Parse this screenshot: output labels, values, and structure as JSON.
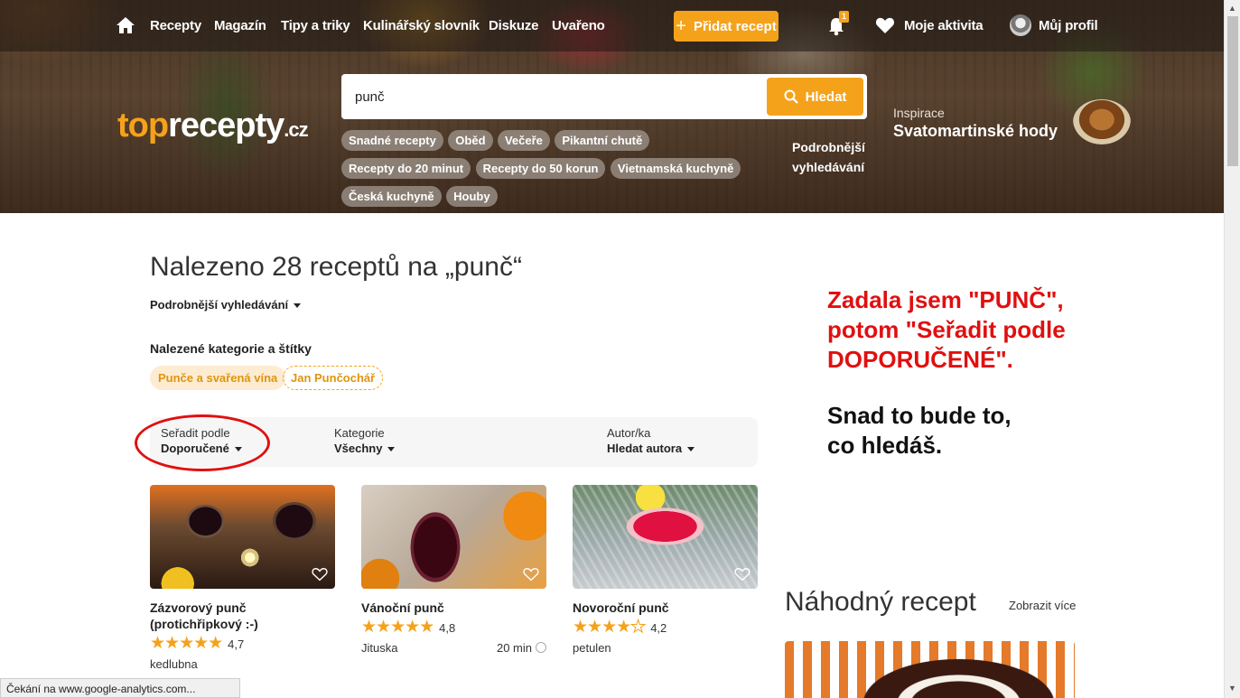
{
  "nav": {
    "home_icon": "home-icon",
    "links": [
      "Recepty",
      "Magazín",
      "Tipy a triky",
      "Kulinářský slovník",
      "Diskuze",
      "Uvařeno"
    ],
    "add_recipe": "Přidat recept",
    "notification_count": "1",
    "activity": "Moje aktivita",
    "profile": "Můj profil"
  },
  "logo": {
    "part1": "top",
    "part2": "recepty",
    "part3": ".cz"
  },
  "search": {
    "value": "punč",
    "button": "Hledat"
  },
  "quick_tags": [
    "Snadné recepty",
    "Oběd",
    "Večeře",
    "Pikantní chutě",
    "Recepty do 20 minut",
    "Recepty do 50 korun",
    "Vietnamská kuchyně",
    "Česká kuchyně",
    "Houby"
  ],
  "advanced_search_hero": "Podrobnější vyhledávání",
  "inspiration": {
    "label": "Inspirace",
    "title": "Svatomartinské hody"
  },
  "results": {
    "title": "Nalezeno 28 receptů na „punč“",
    "advanced_toggle": "Podrobnější vyhledávání",
    "categories_heading": "Nalezené kategorie a štítky",
    "category_tags": [
      "Punče a svařená vína",
      "Jan Punčochář"
    ]
  },
  "filters": [
    {
      "label": "Seřadit podle",
      "value": "Doporučené"
    },
    {
      "label": "Kategorie",
      "value": "Všechny"
    },
    {
      "label": "Autor/ka",
      "value": "Hledat autora"
    }
  ],
  "annotation": {
    "red_lines": [
      "Zadala jsem \"PUNČ\",",
      "potom \"Seřadit podle",
      "DOPORUČENÉ\"."
    ],
    "black_lines": [
      "Snad to bude to,",
      "co hledáš."
    ],
    "color": "#e01010"
  },
  "recipes": [
    {
      "title": "Zázvorový punč (protichřipkový :-)",
      "rating": "4,7",
      "stars": 5,
      "author": "kedlubna",
      "time": ""
    },
    {
      "title": "Vánoční punč",
      "rating": "4,8",
      "stars": 5,
      "author": "Jituska",
      "time": "20 min"
    },
    {
      "title": "Novoroční punč",
      "rating": "4,2",
      "stars": 4,
      "author": "petulen",
      "time": ""
    }
  ],
  "random": {
    "title": "Náhodný recept",
    "more": "Zobrazit více"
  },
  "status_bar": "Čekání na www.google-analytics.com...",
  "colors": {
    "accent": "#f5a21b"
  }
}
